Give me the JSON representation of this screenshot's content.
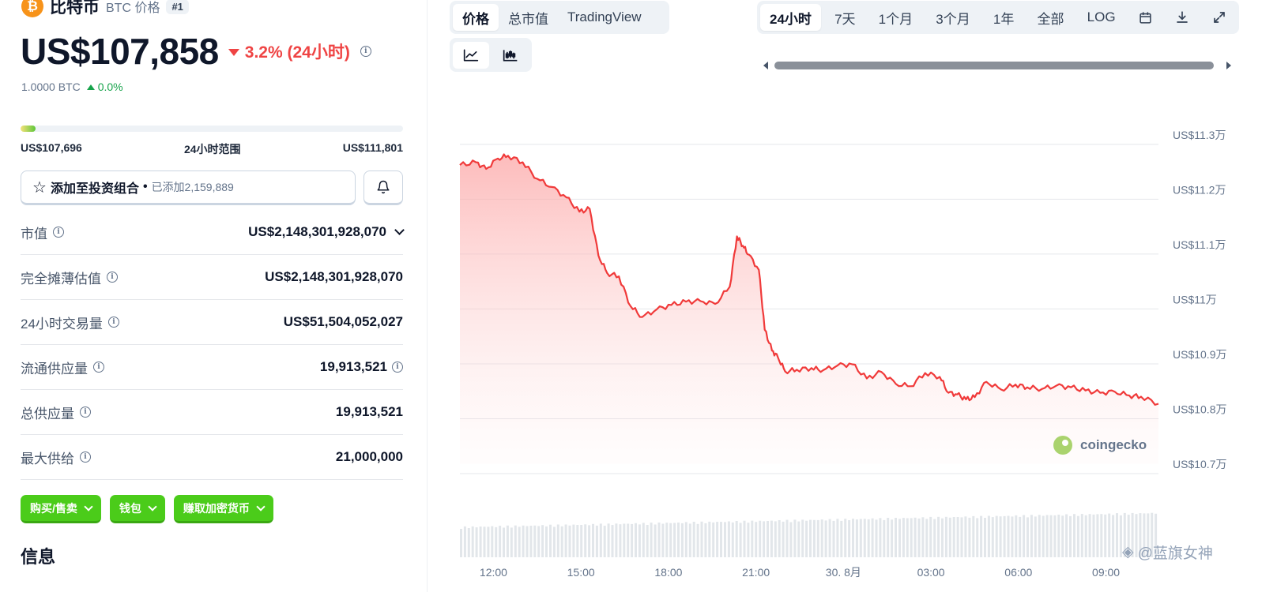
{
  "coin": {
    "logo_glyph": "₿",
    "name": "比特币",
    "symbol_label": "BTC 价格",
    "rank": "#1",
    "price": "US$107,858",
    "change_pct": "3.2% (24小时)",
    "change_direction": "down",
    "btc_amount": "1.0000 BTC",
    "btc_change": "0.0%"
  },
  "range": {
    "low": "US$107,696",
    "label": "24小时范围",
    "high": "US$111,801",
    "fill_fraction": 0.04
  },
  "portfolio": {
    "add_label": "添加至投资组合",
    "added_text": "已添加2,159,889"
  },
  "stats": [
    {
      "label": "市值",
      "value": "US$2,148,301,928,070",
      "info": true,
      "value_icon": "chevron-down-icon"
    },
    {
      "label": "完全摊薄估值",
      "value": "US$2,148,301,928,070",
      "info": true,
      "value_icon": ""
    },
    {
      "label": "24小时交易量",
      "value": "US$51,504,052,027",
      "info": true,
      "value_icon": ""
    },
    {
      "label": "流通供应量",
      "value": "19,913,521",
      "info": true,
      "value_icon": "info-icon"
    },
    {
      "label": "总供应量",
      "value": "19,913,521",
      "info": true,
      "value_icon": ""
    },
    {
      "label": "最大供给",
      "value": "21,000,000",
      "info": true,
      "value_icon": ""
    }
  ],
  "actions": {
    "buy_sell": "购买/售卖",
    "wallet": "钱包",
    "earn": "赚取加密货币"
  },
  "info_heading": "信息",
  "chart_tabs": {
    "price": "价格",
    "market_cap": "总市值",
    "tradingview": "TradingView"
  },
  "time_tabs": [
    "24小时",
    "7天",
    "1个月",
    "3个月",
    "1年",
    "全部",
    "LOG"
  ],
  "watermark": {
    "brand": "coingecko",
    "user": "@蓝旗女神"
  },
  "colors": {
    "line": "#f03a3a",
    "area": "#fecaca",
    "accent_green": "#4bcc1a",
    "down_red": "#ef4444",
    "up_green": "#16a34a"
  },
  "chart_data": {
    "type": "area",
    "ylabel": "",
    "xlabel": "",
    "ylim": [
      107000,
      113300
    ],
    "y_ticks": [
      113000,
      112000,
      111000,
      110000,
      109000,
      108000,
      107000
    ],
    "y_tick_labels": [
      "US$11.3万",
      "US$11.2万",
      "US$11.1万",
      "US$11万",
      "US$10.9万",
      "US$10.8万",
      "US$10.7万"
    ],
    "x_ticks": [
      1.0,
      4.0,
      7.0,
      10.0,
      13.0,
      16.0,
      19.0,
      22.0
    ],
    "x_tick_labels": [
      "12:00",
      "15:00",
      "18:00",
      "21:00",
      "30. 8月",
      "03:00",
      "06:00",
      "09:00"
    ],
    "xlim": [
      -0.15,
      23.8
    ],
    "grid": true,
    "series": [
      {
        "x": [
          -0.15,
          0.4,
          0.75,
          1.15,
          1.5,
          2.0,
          2.5,
          3.0,
          3.5,
          3.95,
          4.3,
          4.6,
          4.9,
          5.3,
          5.7,
          6.1,
          6.6,
          7.1,
          7.6,
          8.1,
          8.6,
          9.1,
          9.35,
          9.55,
          9.75,
          10.1,
          10.3,
          10.55,
          10.75,
          11.0,
          11.4,
          11.9,
          12.3,
          12.8,
          13.3,
          13.8,
          14.3,
          14.8,
          15.3,
          15.8,
          16.3,
          16.6,
          16.9,
          17.2,
          17.5,
          17.9,
          18.4,
          18.9,
          19.3,
          19.8,
          20.3,
          20.8,
          21.3,
          21.8,
          22.3,
          22.8,
          23.2,
          23.8
        ],
        "y": [
          112450,
          112500,
          112380,
          112570,
          112620,
          112500,
          112200,
          112050,
          111860,
          111600,
          111650,
          110800,
          110480,
          110420,
          109880,
          109680,
          109820,
          109900,
          109960,
          109970,
          109920,
          110230,
          111150,
          110980,
          110820,
          110540,
          109450,
          109070,
          108950,
          108690,
          108720,
          108750,
          108710,
          108800,
          108820,
          108560,
          108680,
          108460,
          108420,
          108660,
          108590,
          108300,
          108270,
          108180,
          108220,
          108500,
          108360,
          108450,
          108400,
          108370,
          108430,
          108400,
          108340,
          108300,
          108320,
          108250,
          108230,
          108100
        ]
      }
    ]
  }
}
